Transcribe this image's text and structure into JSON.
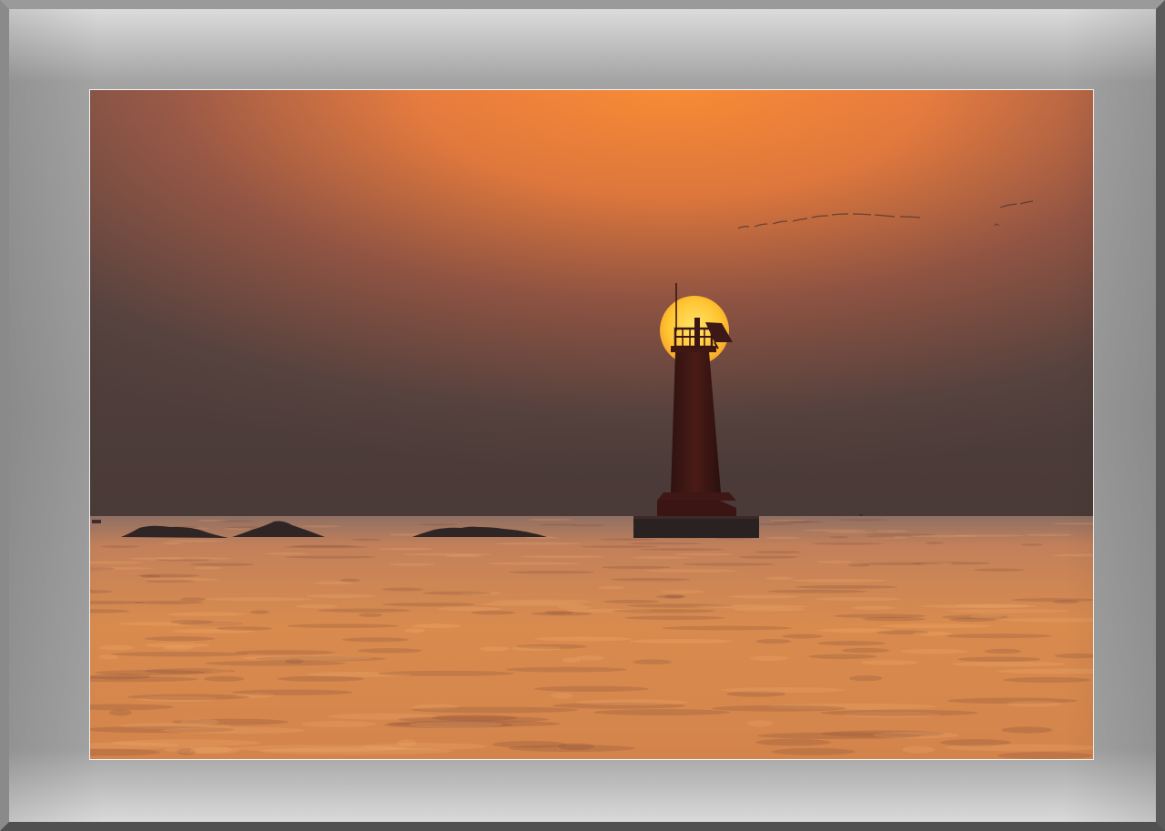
{
  "photo": {
    "subject": "lighthouse-silhouette-at-sunset",
    "colors": {
      "sky_top": "#f4843a",
      "sky_mid": "#a45a45",
      "sky_horizon": "#5b4744",
      "sea": "#d88a4d",
      "sun": "#ffcf3a",
      "silhouette": "#3a1614"
    }
  }
}
